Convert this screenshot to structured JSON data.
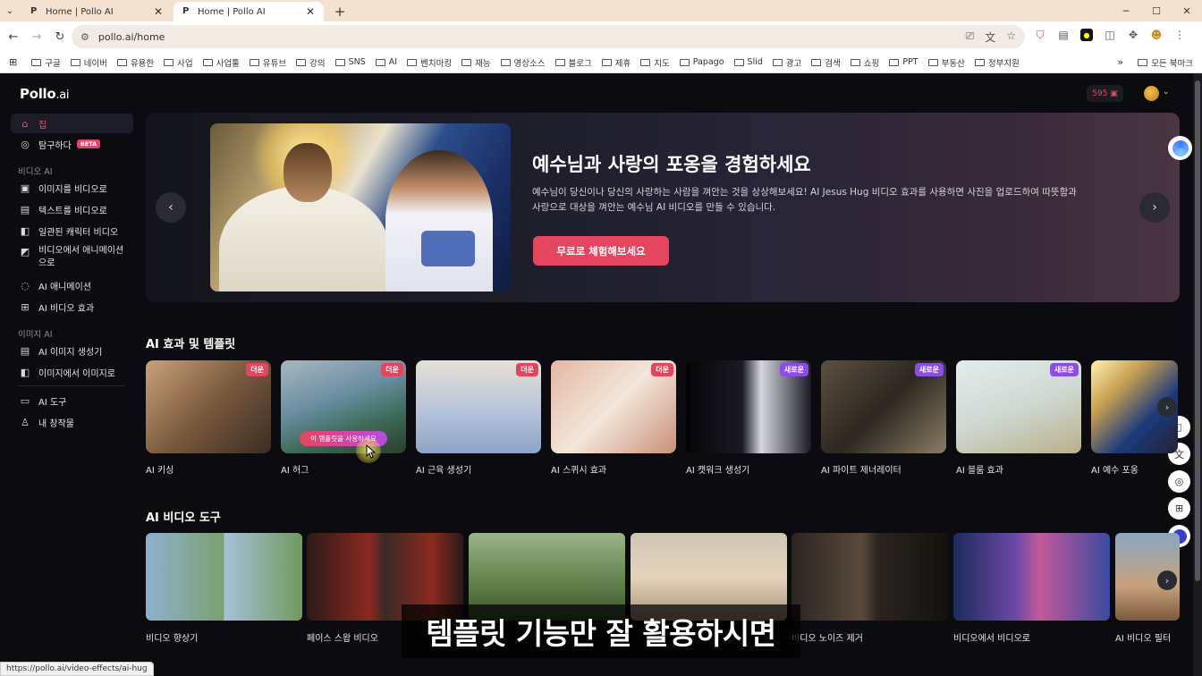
{
  "browser": {
    "tabs": [
      {
        "title": "Home | Pollo AI",
        "favicon": "P"
      },
      {
        "title": "Home | Pollo AI",
        "favicon": "P"
      }
    ],
    "url": "pollo.ai/home",
    "bookmarks": [
      "구글",
      "네이버",
      "유용한",
      "사업",
      "사업툴",
      "유튜브",
      "강의",
      "SNS",
      "AI",
      "벤치마킹",
      "재능",
      "영상소스",
      "블로그",
      "제휴",
      "지도",
      "Papago",
      "Slid",
      "광고",
      "검색",
      "쇼핑",
      "PPT",
      "부동산",
      "정부지원"
    ],
    "all_bookmarks": "모든 북마크",
    "status_url": "https://pollo.ai/video-effects/ai-hug"
  },
  "app": {
    "logo": "Pollo",
    "logo_suffix": ".ai",
    "credits": "595",
    "sidebar": {
      "home": "집",
      "explore": "탐구하다",
      "explore_badge": "BETA",
      "video_section": "비디오 AI",
      "video_items": [
        "이미지를 비디오로",
        "텍스트를 비디오로",
        "일관된 캐릭터 비디오",
        "비디오에서 애니메이션으로",
        "AI 애니메이션",
        "AI 비디오 효과"
      ],
      "image_section": "이미지 AI",
      "image_items": [
        "AI 이미지 생성기",
        "이미지에서 이미지로"
      ],
      "tools": "AI 도구",
      "creations": "내 창작물"
    },
    "hero": {
      "title": "예수님과 사랑의 포옹을 경험하세요",
      "desc_line1": "예수님이 당신이나 당신의 사랑하는 사람을 껴안는 것을 상상해보세요! AI Jesus Hug 비디오 효과를 사용하면 사진을 업로드하여 따뜻함과",
      "desc_line2": "사랑으로 대상을 껴안는 예수님 AI 비디오를 만들 수 있습니다.",
      "cta": "무료로 체험해보세요"
    },
    "effects_title": "AI 효과 및 템플릿",
    "use_template": "이 템플릿을 사용하세요",
    "effects": [
      {
        "label": "AI 키싱",
        "badge": "더운"
      },
      {
        "label": "AI 허그",
        "badge": "더운"
      },
      {
        "label": "AI 근육 생성기",
        "badge": "더운"
      },
      {
        "label": "AI 스퀴시 효과",
        "badge": "더운"
      },
      {
        "label": "AI 캣워크 생성기",
        "badge": "새로운"
      },
      {
        "label": "AI 파이트 제너레이터",
        "badge": "새로운"
      },
      {
        "label": "AI 블룸 효과",
        "badge": "새로운"
      },
      {
        "label": "AI 예수 포옹",
        "badge": ""
      }
    ],
    "tools_title": "AI 비디오 도구",
    "tools": [
      "비디오 향상기",
      "페이스 스왑 비디오",
      "",
      "",
      "비디오 노이즈 제거",
      "",
      "비디오에서 비디오로",
      "AI 비디오 필터"
    ],
    "caption": "템플릿 기능만 잘 활용하시면"
  },
  "colors": {
    "accent": "#e6455f",
    "new_badge": "#8b4de6",
    "bg": "#0b0b10"
  }
}
